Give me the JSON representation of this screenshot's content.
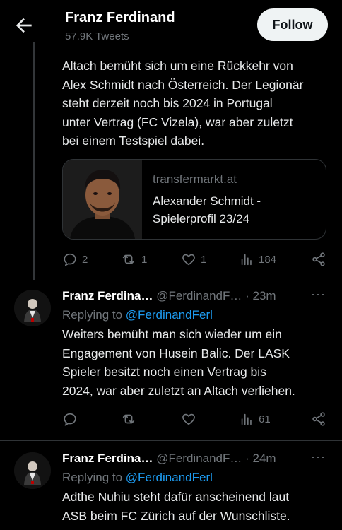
{
  "header": {
    "name": "Franz Ferdinand",
    "tweet_count": "57.9K Tweets",
    "follow_label": "Follow"
  },
  "main_tweet": {
    "text_lines": [
      "Altach bemüht sich um eine Rückkehr von",
      "Alex Schmidt nach Österreich. Der Legionär",
      "steht derzeit noch bis 2024 in Portugal",
      "unter Vertrag (FC Vizela), war aber zuletzt",
      "bei einem Testspiel dabei."
    ],
    "card": {
      "domain": "transfermarkt.at",
      "title_lines": [
        "Alexander Schmidt -",
        "Spielerprofil 23/24"
      ]
    },
    "actions": {
      "replies": "2",
      "retweets": "1",
      "likes": "1",
      "views": "184"
    }
  },
  "replies": [
    {
      "name": "Franz Ferdina…",
      "handle": "@FerdinandF…",
      "time": "· 23m",
      "replying_prefix": "Replying to",
      "replying_to": "@FerdinandFerl",
      "text_lines": [
        "Weiters bemüht man sich wieder um ein",
        "Engagement von Husein Balic. Der LASK",
        "Spieler besitzt noch einen Vertrag bis",
        "2024, war aber zuletzt an Altach verliehen."
      ],
      "actions": {
        "views": "61"
      }
    },
    {
      "name": "Franz Ferdina…",
      "handle": "@FerdinandF…",
      "time": "· 24m",
      "replying_prefix": "Replying to",
      "replying_to": "@FerdinandFerl",
      "text_lines": [
        "Adthe Nuhiu steht dafür anscheinend laut",
        "ASB beim FC Zürich auf der Wunschliste."
      ]
    }
  ],
  "colors": {
    "background": "#000000",
    "text": "#e7e9ea",
    "muted": "#71767b",
    "link": "#1d9bf0",
    "follow_bg": "#eff3f4"
  },
  "icons": [
    "back-arrow-icon",
    "reply-icon",
    "retweet-icon",
    "like-icon",
    "views-icon",
    "share-icon",
    "more-icon"
  ]
}
